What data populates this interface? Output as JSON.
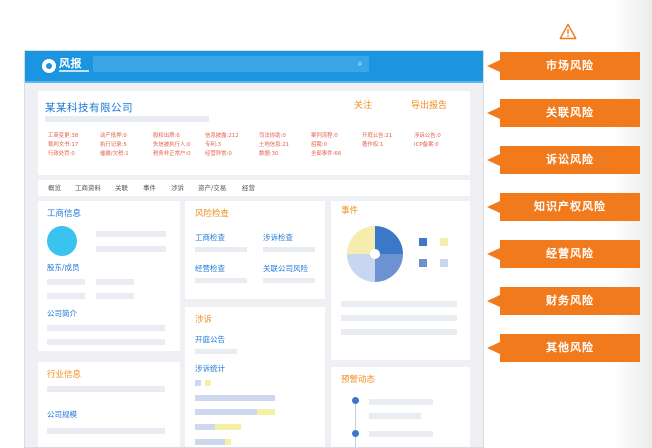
{
  "app": {
    "logo_text": "风报"
  },
  "company": {
    "name": "某某科技有限公司",
    "follow_label": "关注",
    "export_label": "导出报告",
    "stats": [
      [
        "工商变更:38",
        "动产抵押:0",
        "股权出质:6",
        "信息披露:212",
        "司法协助:0",
        "案列流程:0",
        "开庭公告:21",
        "涉诉公告:0"
      ],
      [
        "裁判文书:17",
        "执行记录:5",
        "失信被执行人:0",
        "专利:3",
        "土地信息:21",
        "招聘:0",
        "著作权:1",
        "ICP备案:0"
      ],
      [
        "行政处罚:0",
        "催缴/欠税:1",
        "税务非正常户:0",
        "经营异常:0",
        "数据:30",
        "全部事件:66",
        "",
        ""
      ]
    ]
  },
  "tabs": [
    "概览",
    "工商资料",
    "关联",
    "事件",
    "涉诉",
    "资产/交易",
    "经营"
  ],
  "business_info": {
    "title": "工商信息",
    "shareholders_label": "股东/成员",
    "profile_label": "公司简介"
  },
  "industry_info": {
    "title": "行业信息",
    "scale_label": "公司规模"
  },
  "risk_check": {
    "title": "风险检查",
    "items": [
      "工商检查",
      "涉诉检查",
      "经营检查",
      "关联公司风险"
    ]
  },
  "litigation": {
    "title": "涉诉",
    "hearing_label": "开庭公告",
    "stats_label": "涉诉统计"
  },
  "events": {
    "title": "事件"
  },
  "alerts": {
    "title": "预警动态"
  },
  "risk_labels": [
    "市场风险",
    "关联风险",
    "诉讼风险",
    "知识产权风险",
    "经营风险",
    "财务风险",
    "其他风险"
  ],
  "icons": {
    "warning": "warning-triangle-icon",
    "search": "search-icon"
  },
  "colors": {
    "topbar": "#1b95e0",
    "risk_tag": "#f07a1c",
    "title_blue": "#1e78d6",
    "title_orange": "#f08d1c",
    "stat_red": "#e5604b"
  }
}
